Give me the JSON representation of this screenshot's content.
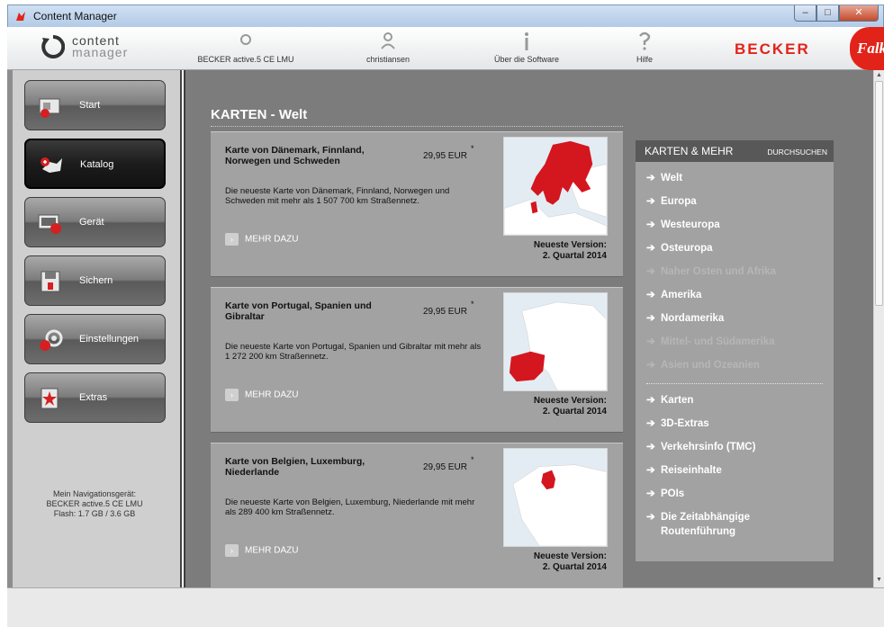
{
  "window": {
    "title": "Content Manager",
    "controls": {
      "minimize": "–",
      "maximize": "□",
      "close": "✕"
    }
  },
  "header": {
    "logo_line1": "content",
    "logo_line2": "manager",
    "items": [
      {
        "label": "BECKER active.5 CE LMU",
        "icon": "device-icon"
      },
      {
        "label": "christiansen",
        "icon": "user-icon"
      },
      {
        "label": "Über die Software",
        "icon": "info-icon"
      },
      {
        "label": "Hilfe",
        "icon": "help-icon"
      }
    ],
    "brand_becker": "BECKER",
    "brand_falk": "Falk"
  },
  "sidebar": {
    "items": [
      {
        "label": "Start",
        "icon": "start-icon",
        "active": false
      },
      {
        "label": "Katalog",
        "icon": "catalog-icon",
        "active": true
      },
      {
        "label": "Gerät",
        "icon": "device-manage-icon",
        "active": false
      },
      {
        "label": "Sichern",
        "icon": "save-icon",
        "active": false
      },
      {
        "label": "Einstellungen",
        "icon": "settings-icon",
        "active": false
      },
      {
        "label": "Extras",
        "icon": "extras-icon",
        "active": false
      }
    ],
    "device_info": {
      "line1": "Mein Navigationsgerät:",
      "line2": "BECKER active.5 CE LMU",
      "line3": "Flash: 1.7 GB / 3.6 GB"
    }
  },
  "main": {
    "title": "KARTEN - Welt",
    "products": [
      {
        "title": "Karte von Dänemark, Finnland, Norwegen und Schweden",
        "price": "29,95 EUR",
        "asterisk": "*",
        "description": "Die neueste Karte von Dänemark, Finnland, Norwegen und Schweden mit mehr als 1 507 700 km Straßennetz.",
        "more": "MEHR DAZU",
        "version_label": "Neueste Version:",
        "version_value": "2. Quartal 2014"
      },
      {
        "title": "Karte von Portugal, Spanien und Gibraltar",
        "price": "29,95 EUR",
        "asterisk": "*",
        "description": "Die neueste Karte von Portugal, Spanien und Gibraltar mit mehr als 1 272 200 km Straßennetz.",
        "more": "MEHR DAZU",
        "version_label": "Neueste Version:",
        "version_value": "2. Quartal 2014"
      },
      {
        "title": "Karte von Belgien, Luxemburg, Niederlande",
        "price": "29,95 EUR",
        "asterisk": "*",
        "description": "Die neueste Karte von Belgien, Luxemburg, Niederlande mit mehr als 289 400 km Straßennetz.",
        "more": "MEHR DAZU",
        "version_label": "Neueste Version:",
        "version_value": "2. Quartal 2014"
      }
    ]
  },
  "panel": {
    "title": "KARTEN & MEHR",
    "search": "DURCHSUCHEN",
    "arrow": "➔",
    "regions": [
      {
        "label": "Welt",
        "state": "current"
      },
      {
        "label": "Europa",
        "state": "normal"
      },
      {
        "label": "Westeuropa",
        "state": "normal"
      },
      {
        "label": "Osteuropa",
        "state": "normal"
      },
      {
        "label": "Naher Osten und Afrika",
        "state": "disabled"
      },
      {
        "label": "Amerika",
        "state": "normal"
      },
      {
        "label": "Nordamerika",
        "state": "normal"
      },
      {
        "label": "Mittel- und Südamerika",
        "state": "disabled"
      },
      {
        "label": "Asien und Ozeanien",
        "state": "disabled"
      }
    ],
    "categories": [
      {
        "label": "Karten"
      },
      {
        "label": "3D-Extras"
      },
      {
        "label": "Verkehrsinfo (TMC)"
      },
      {
        "label": "Reiseinhalte"
      },
      {
        "label": "POIs"
      },
      {
        "label": "Die Zeitabhängige Routenführung"
      }
    ]
  },
  "colors": {
    "brand_red": "#e2231a",
    "content_bg": "#7c7c7c",
    "card_bg": "#a2a2a2",
    "panel_header": "#585858"
  }
}
